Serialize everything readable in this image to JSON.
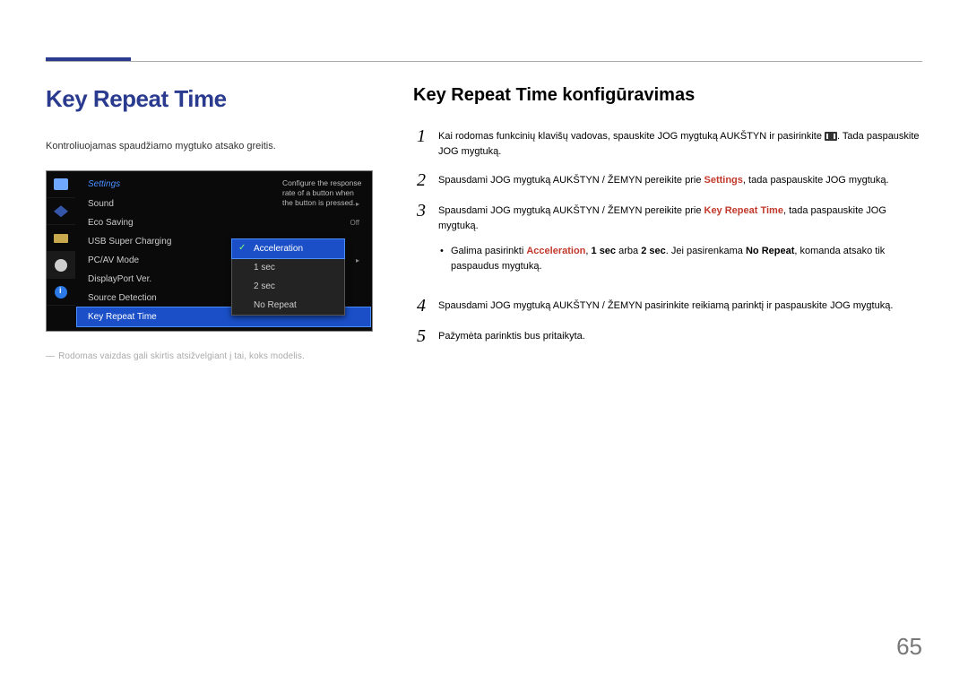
{
  "page_number": "65",
  "left": {
    "title": "Key Repeat Time",
    "intro": "Kontroliuojamas spaudžiamo mygtuko atsako greitis.",
    "footnote": "Rodomas vaizdas gali skirtis atsižvelgiant į tai, koks modelis.",
    "osd": {
      "header": "Settings",
      "desc": "Configure the response rate of a button when the button is pressed.",
      "items": [
        {
          "label": "Sound",
          "value": "▸"
        },
        {
          "label": "Eco Saving",
          "value": "Off"
        },
        {
          "label": "USB Super Charging",
          "value": ""
        },
        {
          "label": "PC/AV Mode",
          "value": "▸"
        },
        {
          "label": "DisplayPort Ver.",
          "value": ""
        },
        {
          "label": "Source Detection",
          "value": ""
        },
        {
          "label": "Key Repeat Time",
          "value": "",
          "selected": true
        }
      ],
      "dropdown": [
        {
          "label": "Acceleration",
          "selected": true,
          "checked": true
        },
        {
          "label": "1 sec"
        },
        {
          "label": "2 sec"
        },
        {
          "label": "No Repeat"
        }
      ]
    }
  },
  "right": {
    "title": "Key Repeat Time konfigūravimas",
    "steps": {
      "s1a": "Kai rodomas funkcinių klavišų vadovas, spauskite JOG mygtuką AUKŠTYN ir pasirinkite ",
      "s1b": ". Tada paspauskite JOG mygtuką.",
      "s2a": "Spausdami JOG mygtuką AUKŠTYN / ŽEMYN pereikite prie ",
      "s2b": "Settings",
      "s2c": ", tada paspauskite JOG mygtuką.",
      "s3a": "Spausdami JOG mygtuką AUKŠTYN / ŽEMYN pereikite prie ",
      "s3b": "Key Repeat Time",
      "s3c": ", tada paspauskite JOG mygtuką.",
      "bullet_a": "Galima pasirinkti ",
      "bullet_accel": "Acceleration",
      "bullet_comma1": ", ",
      "bullet_1sec": "1 sec",
      "bullet_or": " arba ",
      "bullet_2sec": "2 sec",
      "bullet_dot": ". Jei pasirenkama ",
      "bullet_norepeat": "No Repeat",
      "bullet_tail": ", komanda atsako tik paspaudus mygtuką.",
      "s4": "Spausdami JOG mygtuką AUKŠTYN / ŽEMYN pasirinkite reikiamą parinktį ir paspauskite JOG mygtuką.",
      "s5": "Pažymėta parinktis bus pritaikyta."
    }
  }
}
